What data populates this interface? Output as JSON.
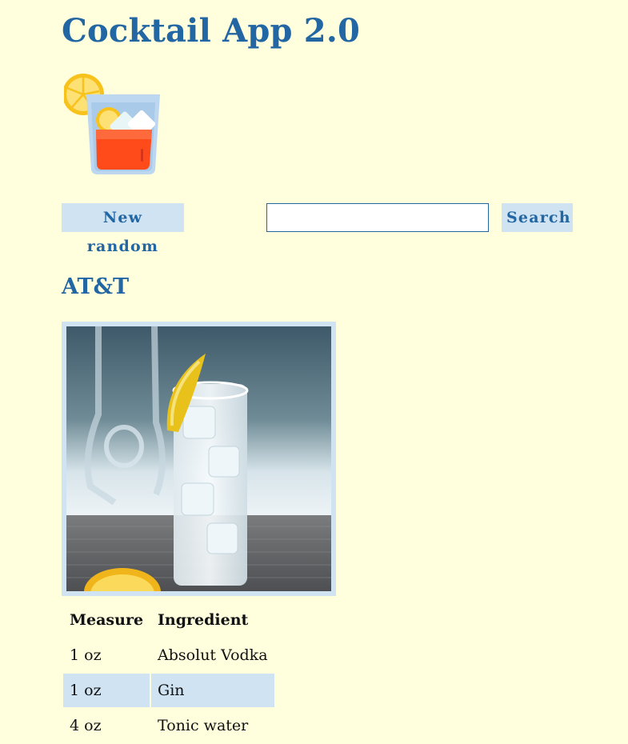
{
  "app": {
    "title": "Cocktail App 2.0",
    "logo_icon": "cocktail-glass-icon"
  },
  "toolbar": {
    "random_label": "New random",
    "search_label": "Search",
    "search_value": "",
    "search_placeholder": ""
  },
  "drink": {
    "name": "AT&T",
    "image_icon": "drink-photo",
    "table": {
      "headers": [
        "Measure",
        "Ingredient"
      ],
      "rows": [
        {
          "measure": "1 oz",
          "ingredient": "Absolut Vodka"
        },
        {
          "measure": "1 oz",
          "ingredient": "Gin"
        },
        {
          "measure": "4 oz",
          "ingredient": "Tonic water"
        }
      ]
    }
  },
  "colors": {
    "background": "#fffedd",
    "accent": "#2266a3",
    "highlight": "#cfe3f3"
  }
}
